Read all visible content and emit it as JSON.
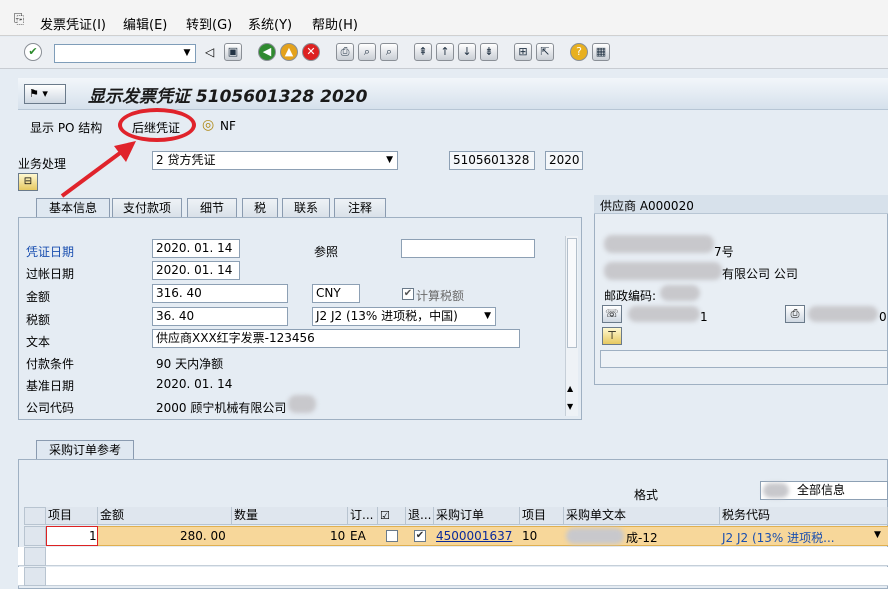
{
  "menu": {
    "items": [
      "发票凭证(I)",
      "编辑(E)",
      "转到(G)",
      "系统(Y)",
      "帮助(H)"
    ]
  },
  "title": "显示发票凭证 5105601328 2020",
  "apptoolbar": {
    "po_structure": "显示 PO 结构",
    "follow_doc": "后继凭证",
    "nf": "NF"
  },
  "header": {
    "business_label": "业务处理",
    "business_value": "2 贷方凭证",
    "doc_number": "5105601328",
    "year": "2020"
  },
  "tabs": [
    "基本信息",
    "支付款项",
    "细节",
    "税",
    "联系",
    "注释"
  ],
  "basic": {
    "doc_date_label": "凭证日期",
    "doc_date": "2020. 01. 14",
    "ref_label": "参照",
    "post_date_label": "过帐日期",
    "post_date": "2020. 01. 14",
    "amount_label": "金额",
    "amount": "316. 40",
    "currency": "CNY",
    "calc_tax_label": "计算税额",
    "tax_label": "税额",
    "tax": "36. 40",
    "tax_code": "J2 J2 (13% 进项税，中国)",
    "text_label": "文本",
    "text_value": "供应商XXX红字发票-123456",
    "pay_terms_label": "付款条件",
    "pay_terms": "90 天内净额",
    "base_date_label": "基准日期",
    "base_date": "2020. 01. 14",
    "company_label": "公司代码",
    "company": "2000 顾宁机械有限公司"
  },
  "vendor": {
    "title": "供应商 A000020",
    "line1_tail": "7号",
    "line2_tail": "有限公司 公司",
    "postal_label": "邮政编码:",
    "phone_tail": "1",
    "fax_tail": "0"
  },
  "po_ref": {
    "tab": "采购订单参考",
    "format_label": "格式",
    "format_value": "全部信息"
  },
  "grid": {
    "headers": [
      "项目",
      "金额",
      "数量",
      "订...",
      "",
      "退...",
      "采购订单",
      "项目",
      "采购单文本",
      "税务代码"
    ],
    "row": {
      "item": "1",
      "amount": "280. 00",
      "qty": "10",
      "unit": "EA",
      "po": "4500001637",
      "po_item": "10",
      "po_text_tail": "成-12",
      "tax_code": "J2 J2 (13% 进项税..."
    }
  },
  "colors": {
    "accent_red": "#e0232b",
    "row_highlight": "#f7d79a"
  }
}
